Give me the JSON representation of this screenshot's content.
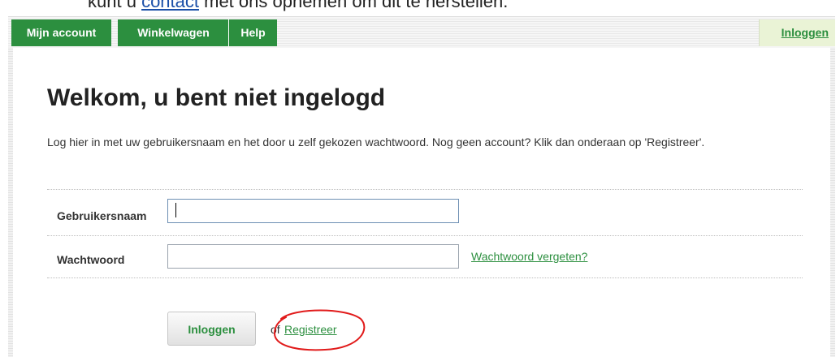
{
  "top_notice": {
    "prefix": "kunt u",
    "link": "contact",
    "suffix": "met ons opnemen om dit te herstellen."
  },
  "nav": {
    "tabs": [
      "Mijn account",
      "Winkelwagen",
      "Help"
    ],
    "login_link": "Inloggen"
  },
  "page": {
    "title": "Welkom, u bent niet ingelogd",
    "intro": "Log hier in met uw gebruikersnaam en het door u zelf gekozen wachtwoord. Nog geen account? Klik dan onderaan op 'Registreer'."
  },
  "form": {
    "username_label": "Gebruikersnaam",
    "username_value": "",
    "password_label": "Wachtwoord",
    "password_value": "",
    "forgot_link": "Wachtwoord vergeten?",
    "login_button": "Inloggen",
    "or_text": "of",
    "register_link": "Registreer"
  },
  "colors": {
    "brand_green": "#2c8f3f",
    "annotation_red": "#e11b1b"
  }
}
